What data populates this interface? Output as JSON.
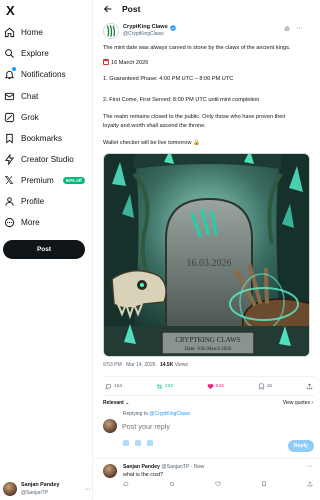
{
  "nav": {
    "logo": "X",
    "items": [
      {
        "label": "Home",
        "icon": "home-icon"
      },
      {
        "label": "Explore",
        "icon": "search-icon"
      },
      {
        "label": "Notifications",
        "icon": "bell-icon"
      },
      {
        "label": "Chat",
        "icon": "mail-icon"
      },
      {
        "label": "Grok",
        "icon": "grok-icon"
      },
      {
        "label": "Bookmarks",
        "icon": "bookmark-icon"
      },
      {
        "label": "Creator Studio",
        "icon": "lightning-icon"
      },
      {
        "label": "Premium",
        "icon": "x-icon",
        "badge": "50% off"
      },
      {
        "label": "Profile",
        "icon": "person-icon"
      },
      {
        "label": "More",
        "icon": "more-circle-icon"
      }
    ],
    "post_button": "Post"
  },
  "account": {
    "name": "Sanjan Pandey",
    "handle": "@SanjanTP",
    "more": "···"
  },
  "header": {
    "title": "Post"
  },
  "tweet": {
    "author_name": "CryptKing Claws",
    "author_handle": "@CryptKingClaws",
    "text": {
      "line1": "The mint date was always carved in stone by the claws of the ancient kings.",
      "date_line": "16 March 2026",
      "phase1": "1. Guaranteed Phase: 4:00 PM UTC – 8:00 PM UTC",
      "phase2": "2. First Come, First Served: 8:00 PM UTC until mint completion",
      "realm1": "The realm remains closed to the public. Only those who have proven their",
      "realm2": "loyalty and worth shall ascend the throne.",
      "wallet": "Wallet checker will be live tomorrow 🔒"
    },
    "image": {
      "grave_date": "16.03.2026",
      "plaque_title": "CRYPTKING CLAWS",
      "plaque_sub": "Date: 16th March 2026"
    },
    "timestamp": "9:53 PM · Mar 14, 2026 · ",
    "views": "14.5K",
    "views_label": " Views",
    "stats": {
      "replies": "164",
      "retweets": "232",
      "likes": "543",
      "bookmarks": "15"
    }
  },
  "sort": {
    "label": "Relevant",
    "view_quotes": "View quotes ›"
  },
  "reply": {
    "replying_prefix": "Replying to ",
    "replying_handle": "@CryptKingClaws",
    "placeholder": "Post your reply",
    "button": "Reply"
  },
  "comment": {
    "name": "Sanjan Pandey",
    "meta": "@SanjanTP · Now",
    "text": "what is the cost?",
    "more": "···"
  },
  "colors": {
    "accent": "#1d9bf0",
    "like": "#f91880",
    "retweet": "#00ba7c",
    "premium_badge": "#00ba7c"
  }
}
